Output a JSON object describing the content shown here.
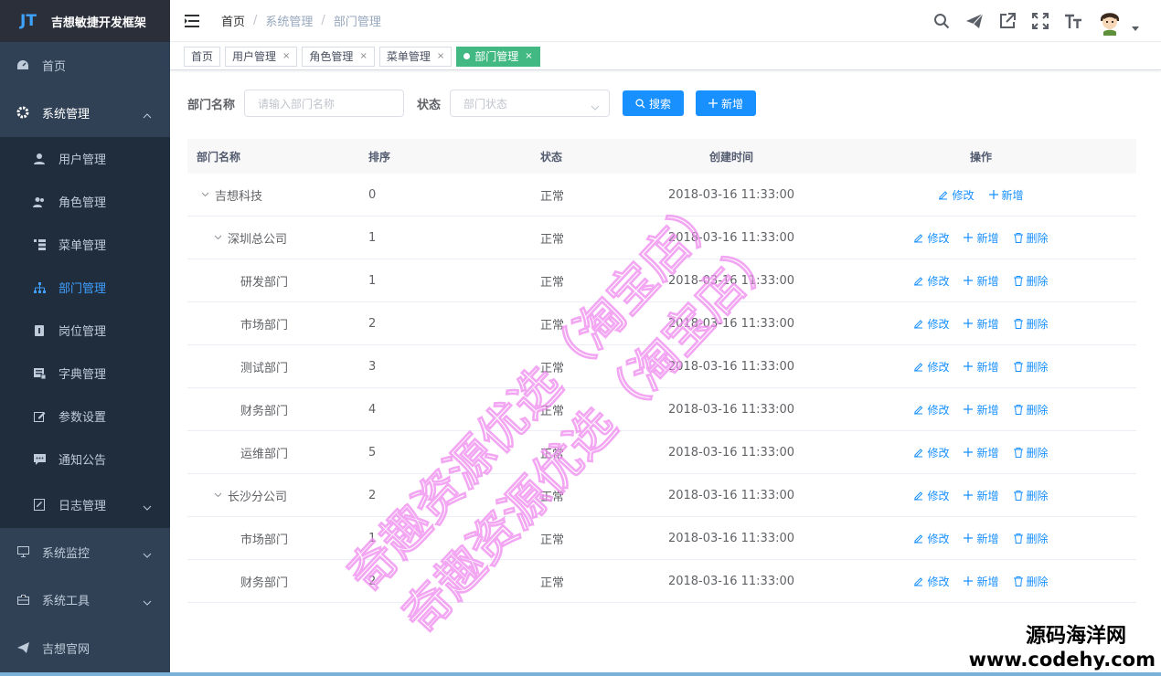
{
  "app": {
    "logo_mark": "JT",
    "title": "吉想敏捷开发框架"
  },
  "sidebar": {
    "items": [
      {
        "label": "首页"
      },
      {
        "label": "系统管理"
      },
      {
        "label": "系统监控"
      },
      {
        "label": "系统工具"
      },
      {
        "label": "吉想官网"
      }
    ],
    "sub_items": [
      {
        "label": "用户管理"
      },
      {
        "label": "角色管理"
      },
      {
        "label": "菜单管理"
      },
      {
        "label": "部门管理"
      },
      {
        "label": "岗位管理"
      },
      {
        "label": "字典管理"
      },
      {
        "label": "参数设置"
      },
      {
        "label": "通知公告"
      },
      {
        "label": "日志管理"
      }
    ]
  },
  "breadcrumb": [
    "首页",
    "系统管理",
    "部门管理"
  ],
  "tags": [
    "首页",
    "用户管理",
    "角色管理",
    "菜单管理",
    "部门管理"
  ],
  "search": {
    "name_label": "部门名称",
    "name_placeholder": "请输入部门名称",
    "status_label": "状态",
    "status_placeholder": "部门状态",
    "search_button": "搜索",
    "add_button": "新增"
  },
  "table": {
    "headers": [
      "部门名称",
      "排序",
      "状态",
      "创建时间",
      "操作"
    ],
    "rows": [
      {
        "name": "吉想科技",
        "order": "0",
        "status": "正常",
        "created": "2018-03-16 11:33:00"
      },
      {
        "name": "深圳总公司",
        "order": "1",
        "status": "正常",
        "created": "2018-03-16 11:33:00"
      },
      {
        "name": "研发部门",
        "order": "1",
        "status": "正常",
        "created": "2018-03-16 11:33:00"
      },
      {
        "name": "市场部门",
        "order": "2",
        "status": "正常",
        "created": "2018-03-16 11:33:00"
      },
      {
        "name": "测试部门",
        "order": "3",
        "status": "正常",
        "created": "2018-03-16 11:33:00"
      },
      {
        "name": "财务部门",
        "order": "4",
        "status": "正常",
        "created": "2018-03-16 11:33:00"
      },
      {
        "name": "运维部门",
        "order": "5",
        "status": "正常",
        "created": "2018-03-16 11:33:00"
      },
      {
        "name": "长沙分公司",
        "order": "2",
        "status": "正常",
        "created": "2018-03-16 11:33:00"
      },
      {
        "name": "市场部门",
        "order": "1",
        "status": "正常",
        "created": "2018-03-16 11:33:00"
      },
      {
        "name": "财务部门",
        "order": "2",
        "status": "正常",
        "created": "2018-03-16 11:33:00"
      }
    ],
    "ops": {
      "edit": "修改",
      "add": "新增",
      "delete": "删除"
    }
  },
  "watermark": {
    "line1": "奇趣资源优选（淘宝店）",
    "line2": "奇趣资源优选（淘宝店）"
  },
  "corner_watermark": {
    "line1": "源码海洋网",
    "line2": "www.codehy.com"
  },
  "colors": {
    "sidebar_bg": "#304156",
    "accent": "#1890ff",
    "active_tag": "#42b983"
  }
}
